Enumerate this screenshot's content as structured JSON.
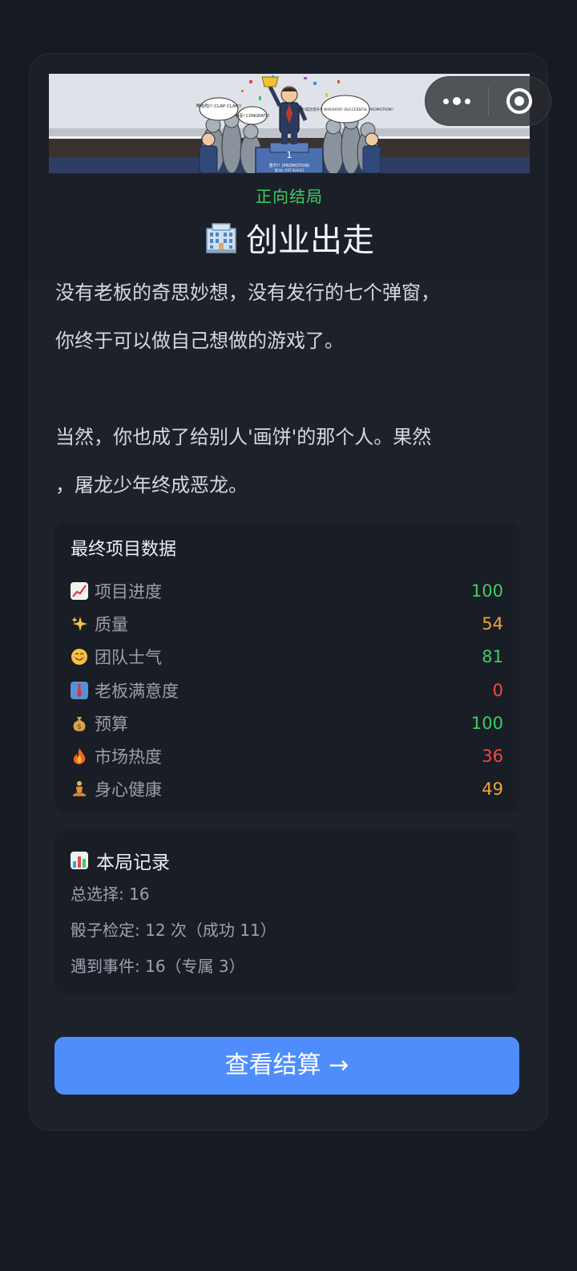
{
  "ending": {
    "tag": "正向结局",
    "title": "创业出走",
    "title_icon": "office-building-icon"
  },
  "illustration": {
    "caption_left": "哗啦啦!! CLAP CLAP!!",
    "caption_mid": "恭喜! CONGRATS!",
    "caption_right": "噢耶!成功晋升!! WOOHOO! SUCCESSFUL PROMOTION!!",
    "podium_number": "1",
    "banner_text": "晋升!! (PROMOTION)",
    "banner_sub": "第1名 (1ST PLACE)"
  },
  "story": {
    "lines": [
      "没有老板的奇思妙想，没有发行的七个弹窗，",
      "你终于可以做自己想做的游戏了。",
      "",
      "当然，你也成了给别人'画饼'的那个人。果然",
      "，屠龙少年终成恶龙。"
    ]
  },
  "stats": {
    "title": "最终项目数据",
    "items": [
      {
        "icon": "chart-increasing-icon",
        "label": "项目进度",
        "value": "100",
        "color": "#3fcb6a"
      },
      {
        "icon": "sparkles-icon",
        "label": "质量",
        "value": "54",
        "color": "#f0a43a"
      },
      {
        "icon": "smiling-face-icon",
        "label": "团队士气",
        "value": "81",
        "color": "#3fcb6a"
      },
      {
        "icon": "necktie-icon",
        "label": "老板满意度",
        "value": "0",
        "color": "#ef4b4b"
      },
      {
        "icon": "money-bag-icon",
        "label": "预算",
        "value": "100",
        "color": "#3fcb6a"
      },
      {
        "icon": "fire-icon",
        "label": "市场热度",
        "value": "36",
        "color": "#ef4b4b"
      },
      {
        "icon": "meditation-icon",
        "label": "身心健康",
        "value": "49",
        "color": "#f0a43a"
      }
    ]
  },
  "record": {
    "title": "本局记录",
    "title_icon": "bar-chart-icon",
    "lines": [
      "总选择: 16",
      "骰子检定: 12 次（成功 11）",
      "遇到事件: 16（专属 3）"
    ]
  },
  "cta": {
    "label": "查看结算 →"
  },
  "capsule": {
    "more_icon": "more-dots-icon",
    "close_icon": "target-close-icon"
  },
  "colors": {
    "accent": "#4f8dfc",
    "positive": "#3fcb6a",
    "warning": "#f0a43a",
    "negative": "#ef4b4b",
    "background": "#161a22",
    "card": "#1d212a"
  }
}
